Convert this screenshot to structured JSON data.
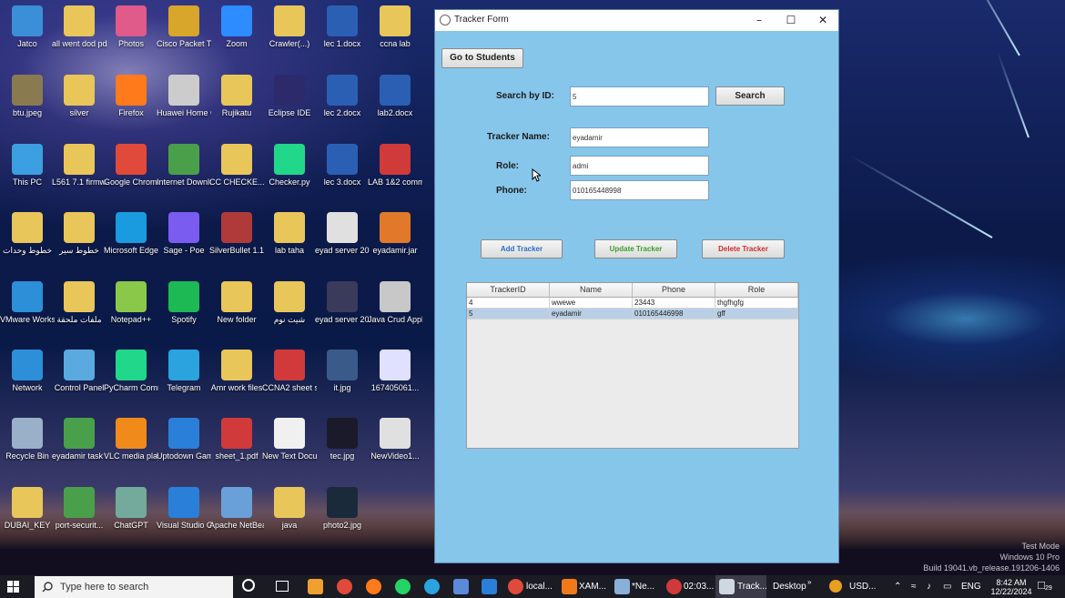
{
  "desktop": {
    "icons": [
      {
        "label": "Jatco",
        "color": "#3b8fd8"
      },
      {
        "label": "all went dod pdf",
        "color": "#e8c65a"
      },
      {
        "label": "Photos",
        "color": "#e05a8a"
      },
      {
        "label": "Cisco Packet Tracer",
        "color": "#d7a62a"
      },
      {
        "label": "Zoom",
        "color": "#2d8cff"
      },
      {
        "label": "Crawler(...)",
        "color": "#e8c65a"
      },
      {
        "label": "lec 1.docx",
        "color": "#2b5fb4"
      },
      {
        "label": "ccna lab",
        "color": "#e8c65a"
      },
      {
        "label": "btu.jpeg",
        "color": "#8a7a50"
      },
      {
        "label": "silver",
        "color": "#e8c65a"
      },
      {
        "label": "Firefox",
        "color": "#ff7a1a"
      },
      {
        "label": "Huawei Home G...",
        "color": "#cccccc"
      },
      {
        "label": "Rujikatu",
        "color": "#e8c65a"
      },
      {
        "label": "Eclipse IDE",
        "color": "#2c2a6a"
      },
      {
        "label": "lec 2.docx",
        "color": "#2b5fb4"
      },
      {
        "label": "lab2.docx",
        "color": "#2b5fb4"
      },
      {
        "label": "This PC",
        "color": "#3b9fe0"
      },
      {
        "label": "L561 7.1 firmware",
        "color": "#e8c65a"
      },
      {
        "label": "Google Chrome",
        "color": "#e04a3a"
      },
      {
        "label": "Internet Downloa...",
        "color": "#4aa04a"
      },
      {
        "label": "CC CHECKE...",
        "color": "#e8c65a"
      },
      {
        "label": "Checker.py",
        "color": "#21d789"
      },
      {
        "label": "lec 3.docx",
        "color": "#2b5fb4"
      },
      {
        "label": "LAB 1&2 comman...",
        "color": "#d03a3a"
      },
      {
        "label": "خطوط وحدات",
        "color": "#e8c65a"
      },
      {
        "label": "خطوط سير",
        "color": "#e8c65a"
      },
      {
        "label": "Microsoft Edge",
        "color": "#1a9adf"
      },
      {
        "label": "Sage - Poe",
        "color": "#7a5cf0"
      },
      {
        "label": "SilverBullet 1.1.4.zip",
        "color": "#b03a3a"
      },
      {
        "label": "lab taha",
        "color": "#e8c65a"
      },
      {
        "label": "eyad server 2012 2024 ...",
        "color": "#e0e0e0"
      },
      {
        "label": "eyadamir.jar",
        "color": "#e07a2a"
      },
      {
        "label": "VMware Workstati...",
        "color": "#2d8fd8"
      },
      {
        "label": "ملفات ملحقة",
        "color": "#e8c65a"
      },
      {
        "label": "Notepad++",
        "color": "#8ac84a"
      },
      {
        "label": "Spotify",
        "color": "#1db954"
      },
      {
        "label": "New folder",
        "color": "#e8c65a"
      },
      {
        "label": "شيت نوم",
        "color": "#e8c65a"
      },
      {
        "label": "eyad server 2012 2024 ...",
        "color": "#3a3a5a"
      },
      {
        "label": "Java Crud Applicati...",
        "color": "#c8c8c8"
      },
      {
        "label": "Network",
        "color": "#2d8fd8"
      },
      {
        "label": "Control Panel",
        "color": "#5aaae0"
      },
      {
        "label": "PyCharm Communi...",
        "color": "#21d789"
      },
      {
        "label": "Telegram",
        "color": "#2aa3df"
      },
      {
        "label": "Amr work files",
        "color": "#e8c65a"
      },
      {
        "label": "CCNA2 sheet switch_rout...",
        "color": "#d03a3a"
      },
      {
        "label": "it.jpg",
        "color": "#3a5a8a"
      },
      {
        "label": "167405061...",
        "color": "#e0e0ff"
      },
      {
        "label": "Recycle Bin",
        "color": "#9ab0c8"
      },
      {
        "label": "eyadamir task 1.pkt",
        "color": "#4aa04a"
      },
      {
        "label": "VLC media player",
        "color": "#f08a1a"
      },
      {
        "label": "Uptodown GameLoop...",
        "color": "#2a7fd8"
      },
      {
        "label": "sheet_1.pdf",
        "color": "#d03a3a"
      },
      {
        "label": "New Text Document.txt",
        "color": "#f0f0f0"
      },
      {
        "label": "tec.jpg",
        "color": "#1a1a2a"
      },
      {
        "label": "NewVideo1...",
        "color": "#e0e0e0"
      },
      {
        "label": "DUBAI_KEY",
        "color": "#e8c65a"
      },
      {
        "label": "port-securit...",
        "color": "#4aa04a"
      },
      {
        "label": "ChatGPT",
        "color": "#74aa9c"
      },
      {
        "label": "Visual Studio Code",
        "color": "#2a7fd8"
      },
      {
        "label": "Apache NetBeans I...",
        "color": "#6aa0d8"
      },
      {
        "label": "java",
        "color": "#e8c65a"
      },
      {
        "label": "photo2.jpg",
        "color": "#1a2a3a"
      }
    ],
    "watermark_lines": [
      "Test Mode",
      "Windows 10 Pro",
      "Build 19041.vb_release.191206-1406"
    ]
  },
  "window": {
    "title": "Tracker Form",
    "go_students": "Go to Students",
    "search_label": "Search by ID:",
    "search_value": "5",
    "search_button": "Search",
    "name_label": "Tracker Name:",
    "name_value": "eyadamir",
    "role_label": "Role:",
    "role_value": "admi",
    "phone_label": "Phone:",
    "phone_value": "010165448998",
    "add_button": "Add Tracker",
    "update_button": "Update Tracker",
    "delete_button": "Delete Tracker",
    "add_color": "#2a6fc8",
    "update_color": "#3aa02a",
    "delete_color": "#d02a2a",
    "table": {
      "headers": [
        "TrackerID",
        "Name",
        "Phone",
        "Role"
      ],
      "rows": [
        [
          "4",
          "wwewe",
          "23443",
          "thgfhgfg"
        ],
        [
          "5",
          "eyadamir",
          "010165446998",
          "gff"
        ]
      ]
    }
  },
  "taskbar": {
    "search_placeholder": "Type here to search",
    "items": [
      "local...",
      "XAM...",
      "*Ne...",
      "02:03...",
      "Track..."
    ],
    "desktop_label": "Desktop",
    "usd_label": "USD...",
    "lang": "ENG",
    "time": "8:42 AM",
    "date": "12/22/2024",
    "notif": "29"
  }
}
